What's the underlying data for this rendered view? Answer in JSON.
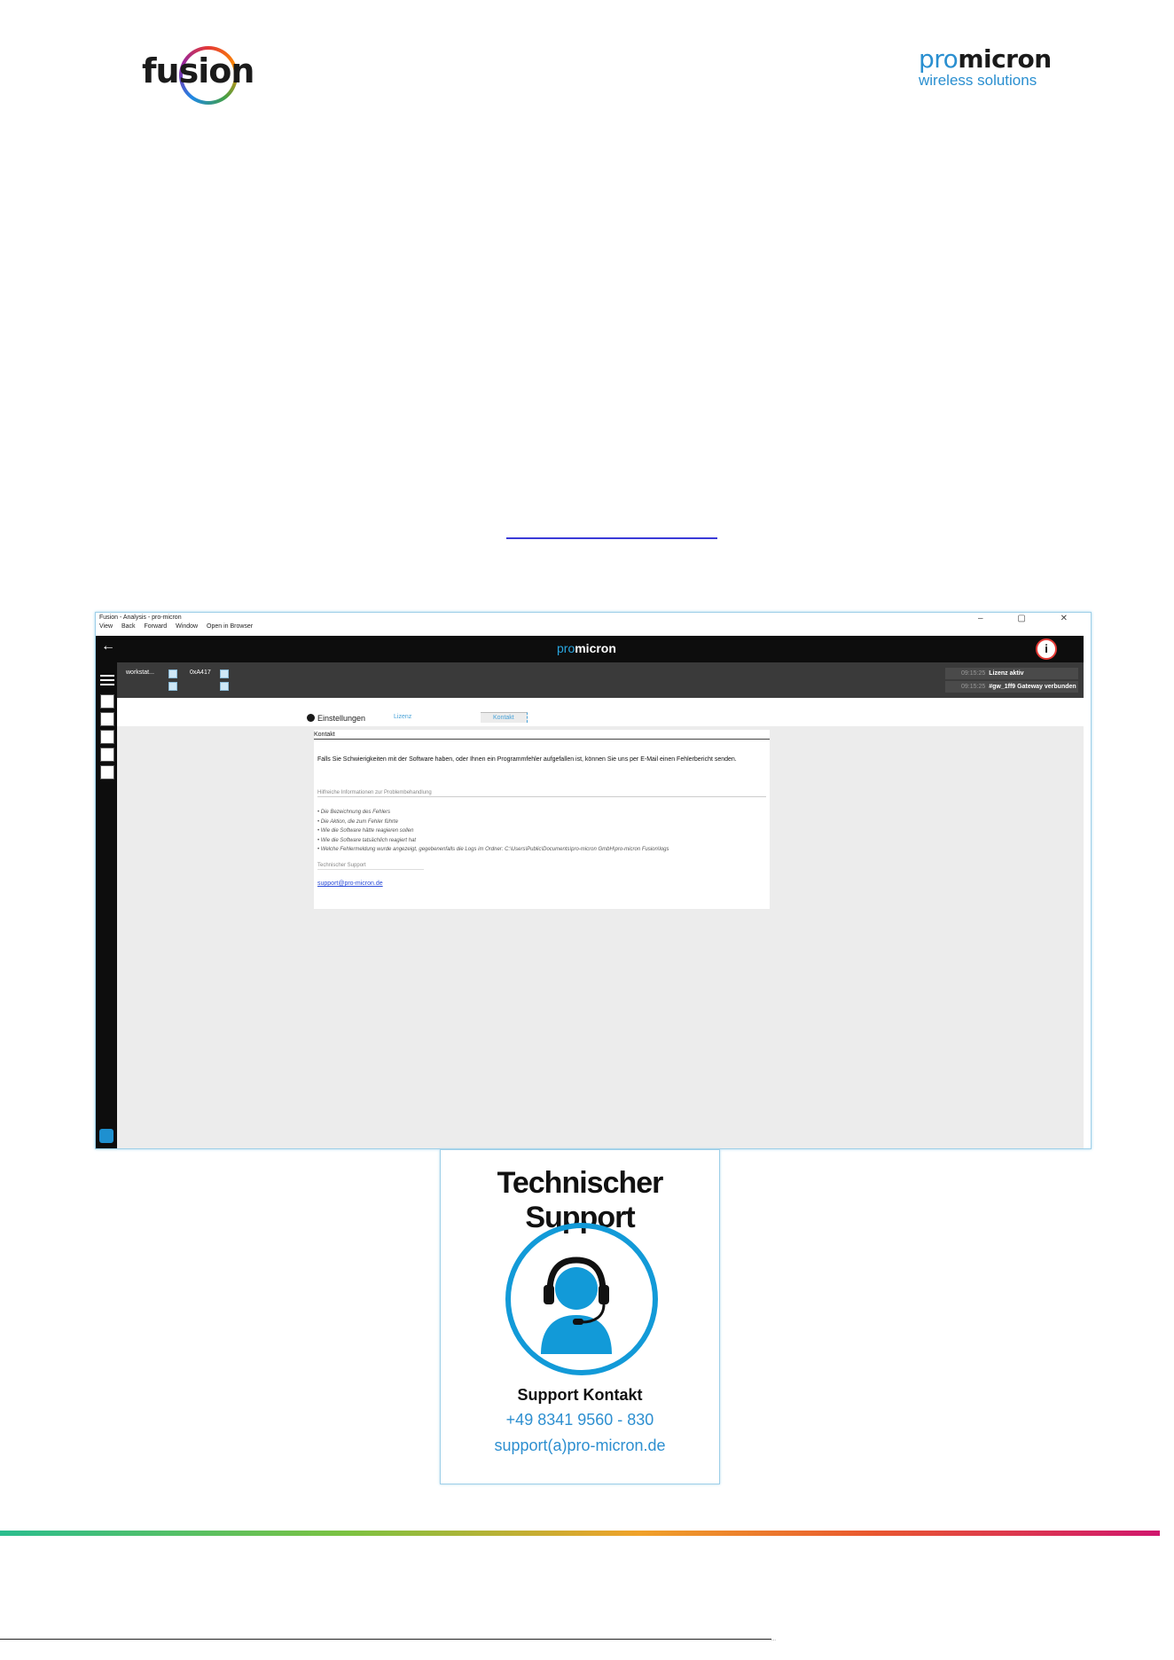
{
  "logos": {
    "fusion": "fusion",
    "promicron_name_a": "pro",
    "promicron_name_b": "micron",
    "promicron_tagline": "wireless solutions"
  },
  "window": {
    "title": "Fusion - Analysis - pro-micron",
    "menu": [
      "View",
      "Back",
      "Forward",
      "Window",
      "Open in Browser"
    ],
    "controls": "– ▢ ✕",
    "back": "←",
    "brand_a": "pro",
    "brand_b": "micron",
    "toolbar": {
      "device": "workstat...",
      "id": "0xA417"
    },
    "status": [
      {
        "time": "09:15:25",
        "text": "Lizenz aktiv"
      },
      {
        "time": "09:15:25",
        "text": "#gw_1ff9 Gateway verbunden"
      }
    ],
    "settings_title": "Einstellungen",
    "tabs": [
      "Lizenz",
      "Kontakt"
    ],
    "panel": {
      "heading": "Kontakt",
      "intro": "Falls Sie Schwierigkeiten mit der Software haben, oder Ihnen ein Programmfehler aufgefallen ist, können Sie uns per E-Mail einen Fehlerbericht senden.",
      "help_heading": "Hilfreiche Informationen zur Problembehandlung",
      "items": [
        "• Die Bezeichnung des Fehlers",
        "• Die Aktion, die zum Fehler führte",
        "• Wie die Software hätte reagieren sollen",
        "• Wie die Software tatsächlich reagiert hat",
        "• Welche Fehlermeldung wurde angezeigt, gegebenenfalls die Logs im Ordner: C:\\Users\\Public\\Documents\\pro-micron GmbH\\pro-micron Fusion\\logs"
      ],
      "support_heading": "Technischer Support",
      "support_email": "support@pro-micron.de"
    }
  },
  "card": {
    "title": "Technischer Support",
    "label": "Support Kontakt",
    "phone": "+49 8341 9560 - 830",
    "email": "support(a)pro-micron.de"
  },
  "footer": {
    "text": "..."
  }
}
